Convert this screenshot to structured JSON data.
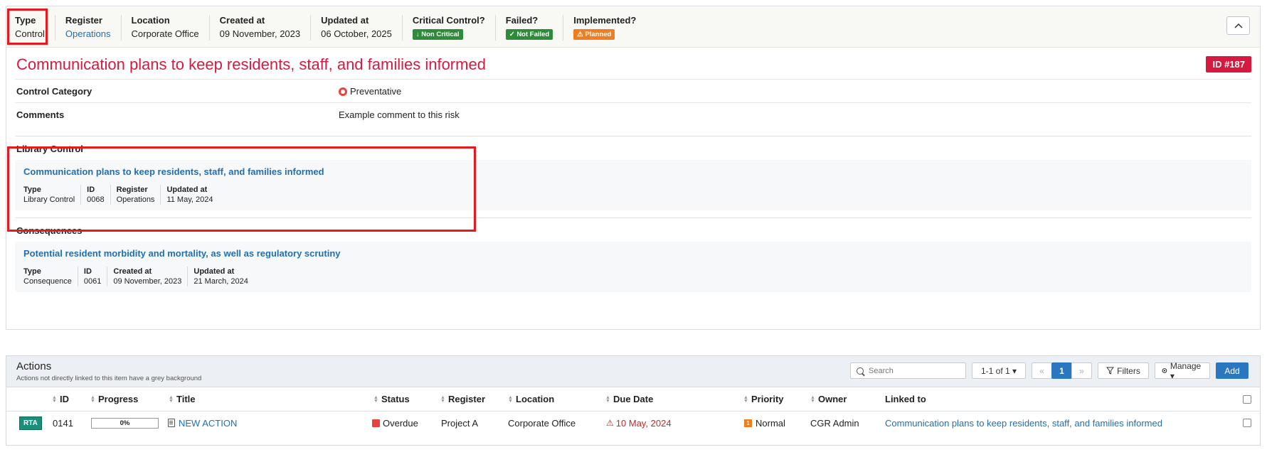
{
  "summary": {
    "type": {
      "label": "Type",
      "value": "Control"
    },
    "register": {
      "label": "Register",
      "value": "Operations"
    },
    "location": {
      "label": "Location",
      "value": "Corporate Office"
    },
    "created": {
      "label": "Created at",
      "value": "09 November, 2023"
    },
    "updated": {
      "label": "Updated at",
      "value": "06 October, 2025"
    },
    "critical": {
      "label": "Critical Control?",
      "value": "↓ Non Critical",
      "color": "#2e8b3a"
    },
    "failed": {
      "label": "Failed?",
      "value": "✓ Not Failed",
      "color": "#2e8b3a"
    },
    "implemented": {
      "label": "Implemented?",
      "value": "⚠ Planned",
      "color": "#ef7d22"
    },
    "collapse_icon": "chevron-up-icon"
  },
  "title": "Communication plans to keep residents, staff, and families informed",
  "id_badge": "ID #187",
  "fields": [
    {
      "label": "Control Category",
      "value": "Preventative"
    },
    {
      "label": "Comments",
      "value": "Example comment to this risk"
    }
  ],
  "library_control": {
    "heading": "Library Control",
    "link": "Communication plans to keep residents, staff, and families informed",
    "meta": [
      {
        "label": "Type",
        "value": "Library Control"
      },
      {
        "label": "ID",
        "value": "0068"
      },
      {
        "label": "Register",
        "value": "Operations"
      },
      {
        "label": "Updated at",
        "value": "11 May, 2024"
      }
    ]
  },
  "consequences": {
    "heading": "Consequences",
    "link": "Potential resident morbidity and mortality, as well as regulatory scrutiny",
    "meta": [
      {
        "label": "Type",
        "value": "Consequence"
      },
      {
        "label": "ID",
        "value": "0061"
      },
      {
        "label": "Created at",
        "value": "09 November, 2023"
      },
      {
        "label": "Updated at",
        "value": "21 March, 2024"
      }
    ]
  },
  "actions": {
    "title": "Actions",
    "subtitle": "Actions not directly linked to this item have a grey background",
    "search_placeholder": "Search",
    "pager": "1-1 of 1 ▾",
    "prev": "«",
    "page": "1",
    "next": "»",
    "filters": "Filters",
    "manage": "Manage ▾",
    "add": "Add",
    "columns": [
      "ID",
      "Progress",
      "Title",
      "Status",
      "Register",
      "Location",
      "Due Date",
      "Priority",
      "Owner",
      "Linked to"
    ],
    "rows": [
      {
        "tag": "RTA",
        "id": "0141",
        "progress": "0%",
        "progress_value": 0,
        "title": "NEW ACTION",
        "status": "Overdue",
        "register": "Project A",
        "location": "Corporate Office",
        "due": "10 May, 2024",
        "priority_num": "1",
        "priority": "Normal",
        "owner": "CGR Admin",
        "linked": "Communication plans to keep residents, staff, and families informed"
      }
    ]
  }
}
